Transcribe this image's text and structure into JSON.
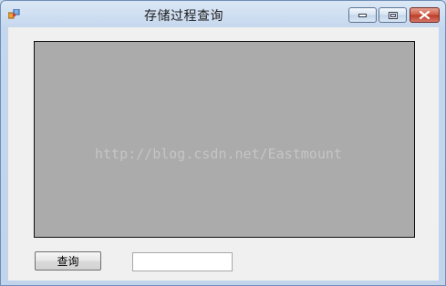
{
  "window": {
    "title": "存储过程查询",
    "icon": "app-icon",
    "controls": [
      "minimize-icon",
      "maximize-icon",
      "close-icon"
    ]
  },
  "grid": {
    "watermark": "http://blog.csdn.net/Eastmount"
  },
  "query": {
    "button_label": "查询",
    "input_value": "",
    "input_placeholder": ""
  },
  "colors": {
    "grid_background": "#ababab",
    "client_background": "#f0f0f0",
    "close_button": "#c8442f"
  }
}
